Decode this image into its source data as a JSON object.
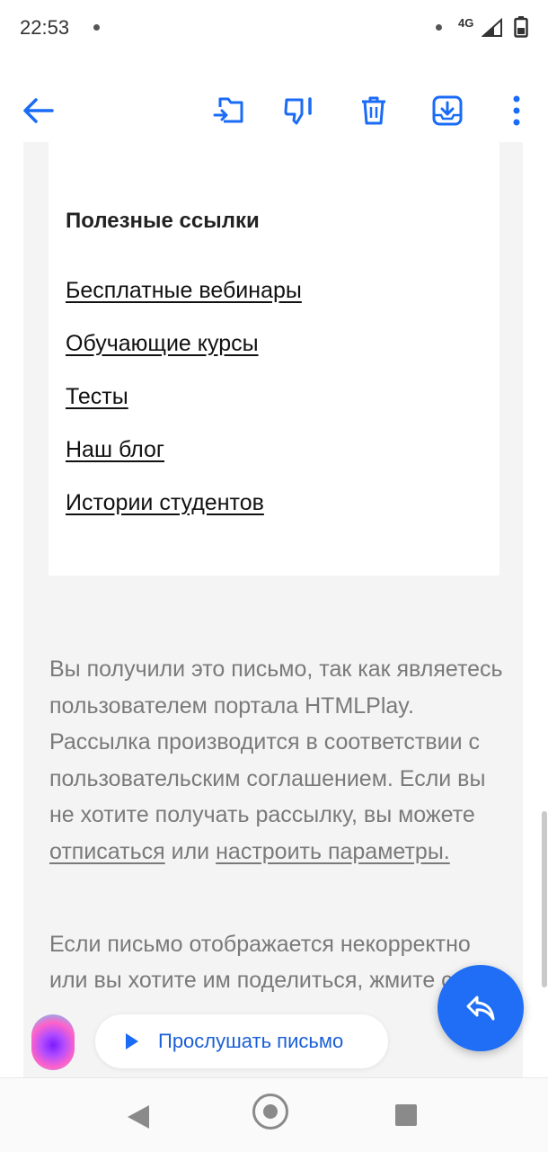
{
  "status_bar": {
    "time": "22:53",
    "network": "4G"
  },
  "toolbar": {
    "icons": [
      "back-arrow-icon",
      "move-to-folder-icon",
      "spam-icon",
      "trash-icon",
      "archive-icon",
      "more-icon"
    ],
    "accent_color": "#1a6bf5"
  },
  "email": {
    "links_title": "Полезные ссылки",
    "links": [
      "Бесплатные вебинары",
      "Обучающие курсы",
      "Тесты",
      "Наш блог",
      "Истории студентов"
    ],
    "footer": {
      "text_before": "Вы получили это письмо, так как являетесь пользователем портала HTMLPlay. Рассылка производится в соответствии с пользовательским соглашением. Если вы не хотите получать рассылку, вы можете ",
      "unsubscribe_link": "отписаться",
      "or": " или ",
      "settings_link": "настроить параметры.",
      "text2": "Если письмо отображается некорректно или вы хотите им поделиться, жмите сюда"
    }
  },
  "bottom": {
    "listen_label": "Прослушать письмо",
    "reply_icon": "reply-icon",
    "assistant_icon": "assistant-orb-icon"
  },
  "nav_bar": {
    "icons": [
      "nav-back-icon",
      "nav-home-icon",
      "nav-recents-icon"
    ]
  }
}
